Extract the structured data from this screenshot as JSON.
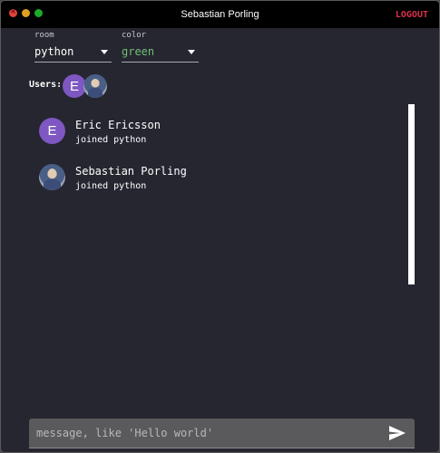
{
  "window": {
    "title": "Sebastian Porling",
    "close_glyph": "×",
    "logout_label": "LOGOUT"
  },
  "room": {
    "label": "room",
    "value": "python"
  },
  "color": {
    "label": "color",
    "value": "green",
    "value_color": "#6fbf73"
  },
  "users": {
    "label": "Users:",
    "avatars": [
      {
        "initial": "E",
        "type": "letter",
        "bg": "#7e57c2"
      },
      {
        "type": "photo"
      }
    ]
  },
  "messages": [
    {
      "author": "Eric Ericsson",
      "text": "joined python",
      "avatar_initial": "E",
      "avatar_type": "letter"
    },
    {
      "author": "Sebastian Porling",
      "text": "joined python",
      "avatar_type": "photo"
    }
  ],
  "composer": {
    "placeholder": "message, like 'Hello world'",
    "value": "",
    "send_icon": "send-icon"
  },
  "colors": {
    "accent_logout": "#d9304a",
    "background": "#262631",
    "avatar_purple": "#7e57c2"
  }
}
